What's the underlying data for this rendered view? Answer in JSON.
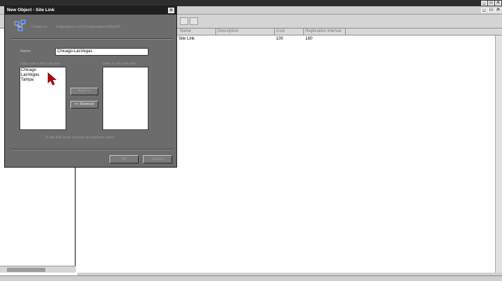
{
  "dialog": {
    "title": "New Object - Site Link",
    "close_glyph": "✕",
    "create_in_label": "Create in:",
    "create_in_path": "fullproduct.com/Configuration/Sites/IP",
    "name_label": "Name:",
    "name_value": "Chicago-LasVegas",
    "sites_not_in_label": "Sites not in this site link:",
    "sites_in_label": "Sites in this site link:",
    "sites_not_in": [
      "Chicago",
      "LasVegas",
      "Tampa"
    ],
    "sites_in": [],
    "add_label": "Add >>",
    "remove_label": "<< Remove",
    "hint": "A site link must contain at least two sites.",
    "ok_label": "OK",
    "cancel_label": "Cancel"
  },
  "background": {
    "window_buttons": [
      "_",
      "□",
      "✕"
    ],
    "inner_buttons": [
      "_",
      "□",
      "✕"
    ],
    "columns": [
      "Name",
      "Description",
      "Cost",
      "Replication Interval"
    ],
    "rows": [
      {
        "name": "Site Link",
        "description": "",
        "cost": "100",
        "interval": "180"
      }
    ]
  },
  "icons": {
    "dialog_icon": "site-link-icon",
    "cursor": "mouse-pointer-icon"
  },
  "colors": {
    "cursor": "#c00000",
    "dialog_body": "#6c6c6c",
    "title_bar": "#1f1f1f"
  }
}
